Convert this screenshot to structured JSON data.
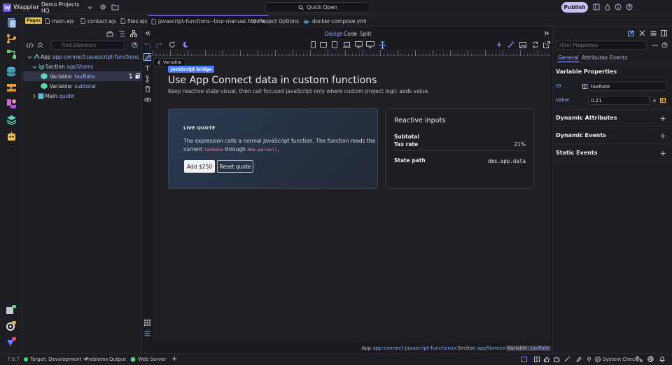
{
  "app": {
    "name": "Wappler",
    "version": "7.9.7"
  },
  "titlebar": {
    "project": "Demo Projects HQ",
    "quick_open": "Quick Open",
    "publish": "Publish"
  },
  "tabs": {
    "pages_badge": "Pages",
    "items": [
      {
        "label": "main.ejs"
      },
      {
        "label": "contact.ejs"
      },
      {
        "label": "files.ejs"
      },
      {
        "label": "javascript-functions--tour-manual.html"
      },
      {
        "label": "Project Options"
      },
      {
        "label": "docker-compose.yml"
      }
    ]
  },
  "left_panel": {
    "find_placeholder": "Find Elements",
    "tree": [
      {
        "type": "App",
        "name": "app-connect-javascript-functions"
      },
      {
        "type": "Section",
        "name": "appStores"
      },
      {
        "type": "Variable:",
        "name": "taxRate"
      },
      {
        "type": "Variable:",
        "name": "subtotal"
      },
      {
        "type": "Main",
        "name": "quote"
      }
    ]
  },
  "design_toolbar": {
    "modes": [
      "Design",
      "Code",
      "Split"
    ],
    "active_mode": "Design"
  },
  "canvas": {
    "chip": "Variable",
    "badge": "JavaScript bridge",
    "title": "Use App Connect data in custom functions",
    "subtitle": "Keep reactive state visual, then call focused JavaScript only where custom project logic adds value.",
    "quote_card": {
      "kicker": "LIVE QUOTE",
      "text_line1": "The expression calls a normal JavaScript function. The function reads the",
      "text_current": "current ",
      "code_taxrate": "taxRate",
      "text_through": " through ",
      "code_parse": "dmx.parse()",
      "text_end": ".",
      "add_button": "Add $250",
      "reset_button": "Reset quote"
    },
    "inputs_card": {
      "title": "Reactive inputs",
      "rows": [
        {
          "label": "Subtotal",
          "value": ""
        },
        {
          "label": "Tax rate",
          "value": "21%"
        },
        {
          "label": "State path",
          "value": "dmx.app.data"
        }
      ]
    }
  },
  "breadcrumb": {
    "app_label": "App ",
    "app_name": "app-connect-javascript-functions",
    "sep": " > ",
    "section_label": "Section ",
    "section_name": "appStores",
    "current_label": "Variable: ",
    "current_name": "taxRate"
  },
  "right_panel": {
    "filter_placeholder": "Filter Properties",
    "tabs": [
      "General",
      "Attributes",
      "Events"
    ],
    "active_tab": "General",
    "section_title": "Variable Properties",
    "id_label": "ID",
    "id_value": "taxRate",
    "value_label": "Value",
    "value_value": "0.21",
    "sections": [
      "Dynamic Attributes",
      "Dynamic Events",
      "Static Events"
    ]
  },
  "statusbar": {
    "target": "Target: Development",
    "problems": "Problems",
    "output": "Output",
    "web_server": "Web Server",
    "system_check": "System Check"
  },
  "colors": {
    "accent": "#8b7cf7",
    "link": "#8fb5ff",
    "badge": "#4a7dff",
    "code": "#f08cb0",
    "publish": "#c9c3f5"
  }
}
